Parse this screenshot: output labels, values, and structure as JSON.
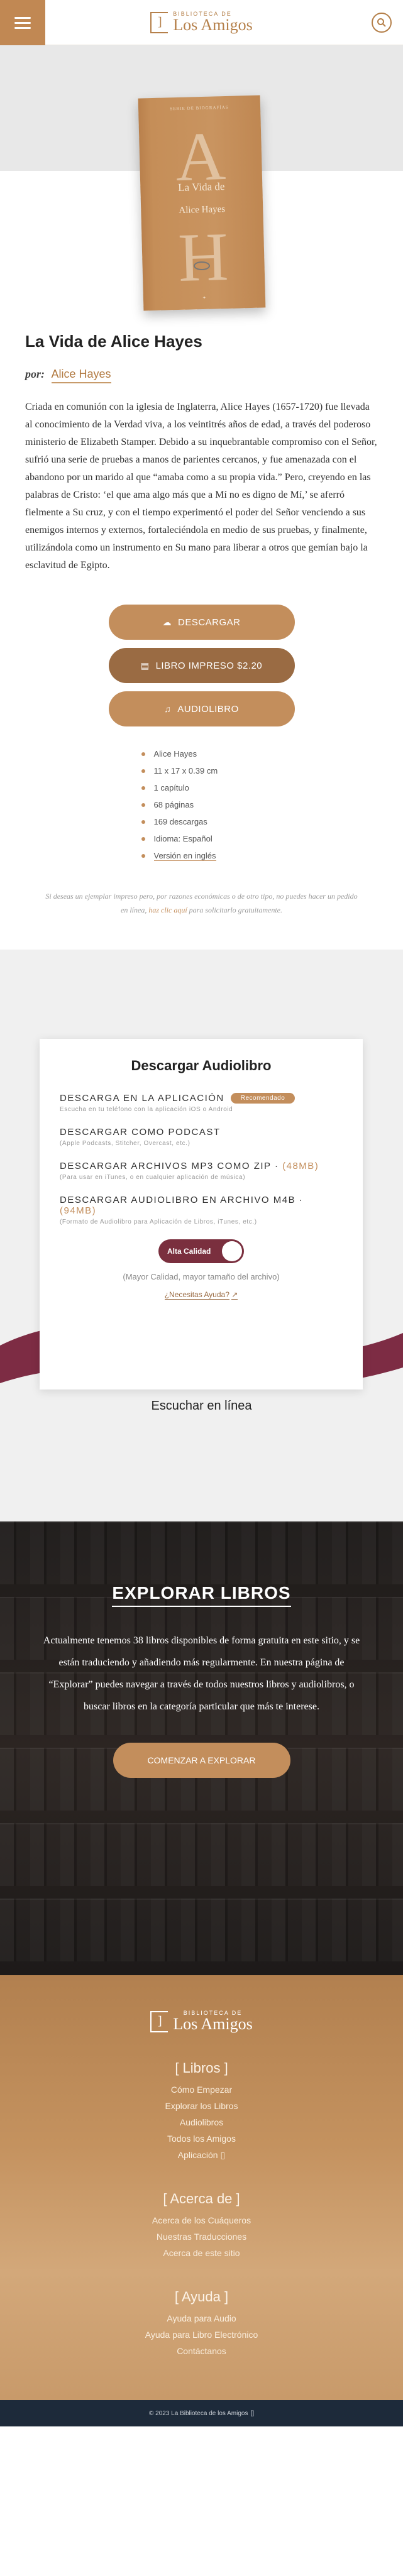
{
  "header": {
    "logo_small": "BIBLIOTECA DE",
    "logo_big": "Los Amigos"
  },
  "book": {
    "cover_series": "SERIE DE BIOGRAFÍAS",
    "cover_title": "La Vida de",
    "cover_author": "Alice Hayes",
    "title": "La Vida de Alice Hayes",
    "author_prefix": "por:",
    "author": "Alice Hayes",
    "description": "Criada en comunión con la iglesia de Inglaterra, Alice Hayes (1657-1720) fue llevada al conocimiento de la Verdad viva, a los veintitrés años de edad, a través del poderoso ministerio de Elizabeth Stamper. Debido a su inquebrantable compromiso con el Señor, sufrió una serie de pruebas a manos de parientes cercanos, y fue amenazada con el abandono por un marido al que “amaba como a su propia vida.” Pero, creyendo en las palabras de Cristo: ‘el que ama algo más que a Mí no es digno de Mí,’ se aferró fielmente a Su cruz, y con el tiempo experimentó el poder del Señor venciendo a sus enemigos internos y externos, fortaleciéndola en medio de sus pruebas, y finalmente, utilizándola como un instrumento en Su mano para liberar a otros que gemían bajo la esclavitud de Egipto."
  },
  "buttons": {
    "download": "DESCARGAR",
    "printed": "LIBRO IMPRESO $2.20",
    "audiobook": "AUDIOLIBRO"
  },
  "specs": [
    "Alice Hayes",
    "11 x 17 x 0.39 cm",
    "1 capítulo",
    "68 páginas",
    "169 descargas",
    "Idioma: Español",
    "Versión en inglés"
  ],
  "note": {
    "before": "Si deseas un ejemplar impreso pero, por razones económicas o de otro tipo, no puedes hacer un pedido en línea, ",
    "link": "haz clic aquí",
    "after": " para solicitarlo gratuitamente."
  },
  "audio": {
    "title": "Descargar Audiolibro",
    "options": [
      {
        "title": "DESCARGA EN LA APLICACIÓN",
        "badge": "Recomendado",
        "size": "",
        "sub": "Escucha en tu teléfono con la aplicación iOS o Android"
      },
      {
        "title": "DESCARGAR COMO PODCAST",
        "badge": "",
        "size": "",
        "sub": "(Apple Podcasts, Stitcher, Overcast, etc.)"
      },
      {
        "title": "DESCARGAR ARCHIVOS MP3 COMO ZIP · ",
        "badge": "",
        "size": "(48MB)",
        "sub": "(Para usar en iTunes, o en cualquier aplicación de música)"
      },
      {
        "title": "DESCARGAR AUDIOLIBRO EN ARCHIVO M4B · ",
        "badge": "",
        "size": "(94MB)",
        "sub": "(Formato de Audiolibro para Aplicación de Libros, iTunes, etc.)"
      }
    ],
    "quality_label": "Alta Calidad",
    "quality_on": true,
    "quality_text": "(Mayor Calidad, mayor tamaño del archivo)",
    "help": "¿Necesitas Ayuda?",
    "listen_online": "Escuchar en línea"
  },
  "explore": {
    "title": "EXPLORAR LIBROS",
    "text": "Actualmente tenemos 38 libros disponibles de forma gratuita en este sitio, y se están traduciendo y añadiendo más regularmente. En nuestra página de “Explorar” puedes navegar a través de todos nuestros libros y audiolibros, o buscar libros en la categoría particular que más te interese.",
    "button": "COMENZAR A EXPLORAR"
  },
  "footer": {
    "sections": [
      {
        "heading": "[ Libros ]",
        "links": [
          "Cómo Empezar",
          "Explorar los Libros",
          "Audiolibros",
          "Todos los Amigos",
          "Aplicación"
        ]
      },
      {
        "heading": "[ Acerca de ]",
        "links": [
          "Acerca de los Cuáqueros",
          "Nuestras Traducciones",
          "Acerca de este sitio"
        ]
      },
      {
        "heading": "[ Ayuda ]",
        "links": [
          "Ayuda para Audio",
          "Ayuda para Libro Electrónico",
          "Contáctanos"
        ]
      }
    ],
    "copyright": "© 2023 La Biblioteca de los Amigos"
  }
}
